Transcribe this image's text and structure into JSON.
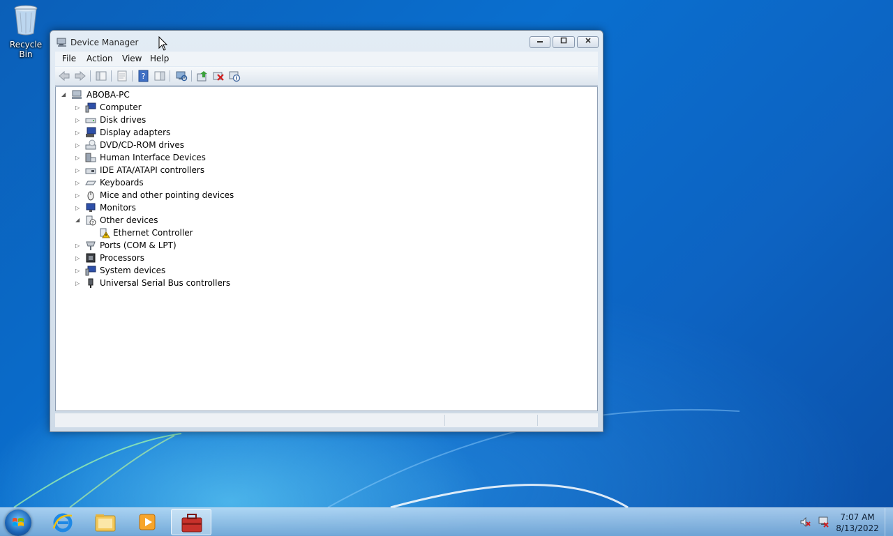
{
  "desktop": {
    "icons": [
      {
        "label": "Recycle Bin",
        "icon": "recycle-bin-icon"
      }
    ]
  },
  "window": {
    "title": "Device Manager",
    "controls": {
      "minimize": "minimize",
      "maximize": "maximize",
      "close": "close"
    },
    "menu": [
      "File",
      "Action",
      "View",
      "Help"
    ],
    "toolbar": [
      "back-icon",
      "forward-icon",
      "show-hide-console-tree-icon",
      "properties-icon",
      "help-icon",
      "action-pane-icon",
      "scan-hardware-icon",
      "update-driver-icon",
      "uninstall-icon",
      "disable-icon"
    ]
  },
  "tree": {
    "root": "ABOBA-PC",
    "categories": [
      {
        "label": "Computer",
        "expanded": false
      },
      {
        "label": "Disk drives",
        "expanded": false
      },
      {
        "label": "Display adapters",
        "expanded": false
      },
      {
        "label": "DVD/CD-ROM drives",
        "expanded": false
      },
      {
        "label": "Human Interface Devices",
        "expanded": false
      },
      {
        "label": "IDE ATA/ATAPI controllers",
        "expanded": false
      },
      {
        "label": "Keyboards",
        "expanded": false
      },
      {
        "label": "Mice and other pointing devices",
        "expanded": false
      },
      {
        "label": "Monitors",
        "expanded": false
      },
      {
        "label": "Other devices",
        "expanded": true,
        "children": [
          {
            "label": "Ethernet Controller",
            "status": "warning"
          }
        ]
      },
      {
        "label": "Ports (COM & LPT)",
        "expanded": false
      },
      {
        "label": "Processors",
        "expanded": false
      },
      {
        "label": "System devices",
        "expanded": false
      },
      {
        "label": "Universal Serial Bus controllers",
        "expanded": false
      }
    ]
  },
  "taskbar": {
    "apps": [
      "internet-explorer-icon",
      "windows-explorer-icon",
      "media-player-icon",
      "device-manager-icon"
    ],
    "tray": [
      "volume-muted-icon",
      "network-error-icon"
    ],
    "time": "7:07 AM",
    "date": "8/13/2022"
  },
  "colors": {
    "desktop": "#0a6fcf",
    "window_frame": "#cfdbe8",
    "warning": "#f5c400"
  }
}
